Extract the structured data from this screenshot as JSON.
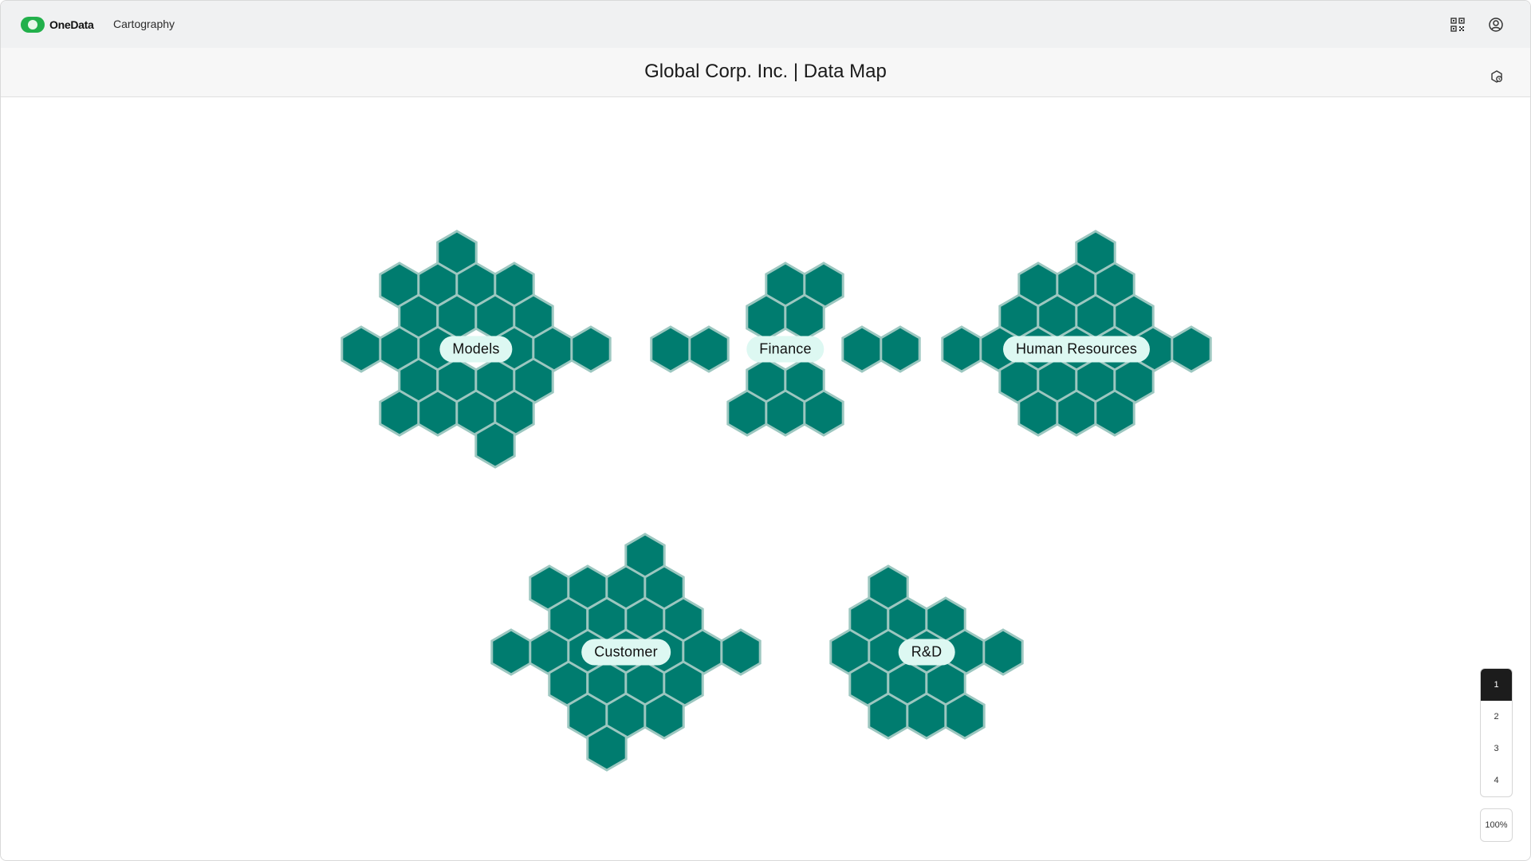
{
  "header": {
    "logo_text": "OneData",
    "app_name": "Cartography",
    "icons": [
      "qr-code-icon",
      "account-icon"
    ]
  },
  "title": {
    "text": "Global Corp. Inc. | Data Map",
    "icon": "settings-icon"
  },
  "colors": {
    "hex_fill": "#007c6f",
    "hex_stroke": "#9cc7c0",
    "label_bg": "#ddf8f2",
    "brand_green": "#22b04b",
    "active_page": "#1c1c1c"
  },
  "clusters": [
    {
      "label": "Models",
      "hex_count": 26
    },
    {
      "label": "Finance",
      "hex_count": 18
    },
    {
      "label": "Human Resources",
      "hex_count": 21
    },
    {
      "label": "Customer",
      "hex_count": 26
    },
    {
      "label": "R&D",
      "hex_count": 19
    }
  ],
  "pagination": {
    "pages": [
      "1",
      "2",
      "3",
      "4"
    ],
    "active": "1"
  },
  "zoom": "100%"
}
